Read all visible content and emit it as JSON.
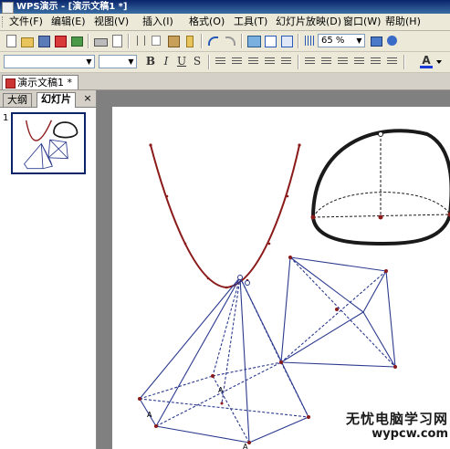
{
  "window": {
    "title": "WPS演示 - [演示文稿1 *]"
  },
  "menu": {
    "items": [
      "文件(F)",
      "编辑(E)",
      "视图(V)",
      "插入(I)",
      "格式(O)",
      "工具(T)",
      "幻灯片放映(D)",
      "窗口(W)",
      "帮助(H)"
    ]
  },
  "toolbar": {
    "zoom": "65 %"
  },
  "format_bar": {
    "bold": "B",
    "italic": "I",
    "underline": "U",
    "strike": "S",
    "font_color": "A"
  },
  "document_tab": {
    "label": "演示文稿1",
    "modified": "*"
  },
  "panel": {
    "tabs": [
      "大纲",
      "幻灯片"
    ],
    "active_tab": "幻灯片",
    "close": "×"
  },
  "slides": [
    {
      "number": "1"
    }
  ],
  "slide_labels": {
    "a1": "A",
    "a2": "A",
    "a3": "A"
  },
  "watermark": {
    "line1": "无忧电脑学习网",
    "line2": "wypcw.com"
  },
  "colors": {
    "curve": "#8b1a1a",
    "pyramid": "#2b3a8f",
    "dome": "#1a1a1a",
    "accent": "#0a246a"
  }
}
